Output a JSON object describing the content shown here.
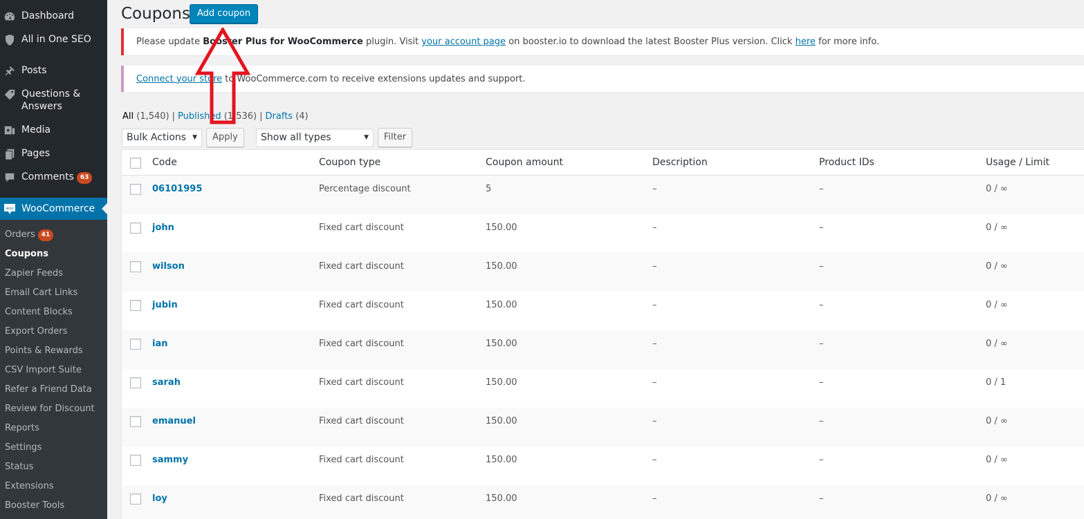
{
  "sidebar": {
    "items": [
      {
        "label": "Dashboard",
        "icon": "dashboard-icon"
      },
      {
        "label": "All in One SEO",
        "icon": "shield-icon"
      },
      {
        "label": "Posts",
        "icon": "pin-icon"
      },
      {
        "label": "Questions & Answers",
        "icon": "tag-icon"
      },
      {
        "label": "Media",
        "icon": "media-icon"
      },
      {
        "label": "Pages",
        "icon": "pages-icon"
      },
      {
        "label": "Comments",
        "icon": "comment-icon",
        "badge": "63"
      },
      {
        "label": "WooCommerce",
        "icon": "woo-icon",
        "icon_text": "woo"
      }
    ],
    "submenu": [
      {
        "label": "Orders",
        "badge": "41"
      },
      {
        "label": "Coupons",
        "current": true
      },
      {
        "label": "Zapier Feeds"
      },
      {
        "label": "Email Cart Links"
      },
      {
        "label": "Content Blocks"
      },
      {
        "label": "Export Orders"
      },
      {
        "label": "Points & Rewards"
      },
      {
        "label": "CSV Import Suite"
      },
      {
        "label": "Refer a Friend Data"
      },
      {
        "label": "Review for Discount"
      },
      {
        "label": "Reports"
      },
      {
        "label": "Settings"
      },
      {
        "label": "Status"
      },
      {
        "label": "Extensions"
      },
      {
        "label": "Booster Tools"
      }
    ]
  },
  "header": {
    "title": "Coupons",
    "add_button": "Add coupon"
  },
  "notices": {
    "update": {
      "t1": "Please update ",
      "bold": "Booster Plus for WooCommerce",
      "t2": " plugin. Visit ",
      "link1": "your account page",
      "t3": " on booster.io to download the latest Booster Plus version. Click ",
      "link2": "here",
      "t4": " for more info."
    },
    "connect": {
      "link": "Connect your store",
      "text": " to WooCommerce.com to receive extensions updates and support."
    }
  },
  "filters": {
    "all_label": "All",
    "all_count": "(1,540)",
    "published_label": "Published",
    "published_count": "(1,536)",
    "drafts_label": "Drafts",
    "drafts_count": "(4)",
    "separator": "|",
    "bulk_actions": "Bulk Actions",
    "apply": "Apply",
    "type_select": "Show all types",
    "filter": "Filter"
  },
  "table": {
    "columns": [
      "Code",
      "Coupon type",
      "Coupon amount",
      "Description",
      "Product IDs",
      "Usage / Limit"
    ],
    "rows": [
      {
        "code": "06101995",
        "type": "Percentage discount",
        "amount": "5",
        "description": "–",
        "product_ids": "–",
        "usage": "0 / ∞"
      },
      {
        "code": "john",
        "type": "Fixed cart discount",
        "amount": "150.00",
        "description": "–",
        "product_ids": "–",
        "usage": "0 / ∞"
      },
      {
        "code": "wilson",
        "type": "Fixed cart discount",
        "amount": "150.00",
        "description": "–",
        "product_ids": "–",
        "usage": "0 / ∞"
      },
      {
        "code": "jubin",
        "type": "Fixed cart discount",
        "amount": "150.00",
        "description": "–",
        "product_ids": "–",
        "usage": "0 / ∞"
      },
      {
        "code": "ian",
        "type": "Fixed cart discount",
        "amount": "150.00",
        "description": "–",
        "product_ids": "–",
        "usage": "0 / ∞"
      },
      {
        "code": "sarah",
        "type": "Fixed cart discount",
        "amount": "150.00",
        "description": "–",
        "product_ids": "–",
        "usage": "0 / 1"
      },
      {
        "code": "emanuel",
        "type": "Fixed cart discount",
        "amount": "150.00",
        "description": "–",
        "product_ids": "–",
        "usage": "0 / ∞"
      },
      {
        "code": "sammy",
        "type": "Fixed cart discount",
        "amount": "150.00",
        "description": "–",
        "product_ids": "–",
        "usage": "0 / ∞"
      },
      {
        "code": "loy",
        "type": "Fixed cart discount",
        "amount": "150.00",
        "description": "–",
        "product_ids": "–",
        "usage": "0 / ∞"
      }
    ]
  },
  "colors": {
    "sidebar_bg": "#23282d",
    "submenu_bg": "#32373c",
    "accent": "#0073aa",
    "primary_button": "#0085ba",
    "badge": "#ca4a1f",
    "notice_error": "#dc3232",
    "annotation_arrow": "#e3141e"
  }
}
